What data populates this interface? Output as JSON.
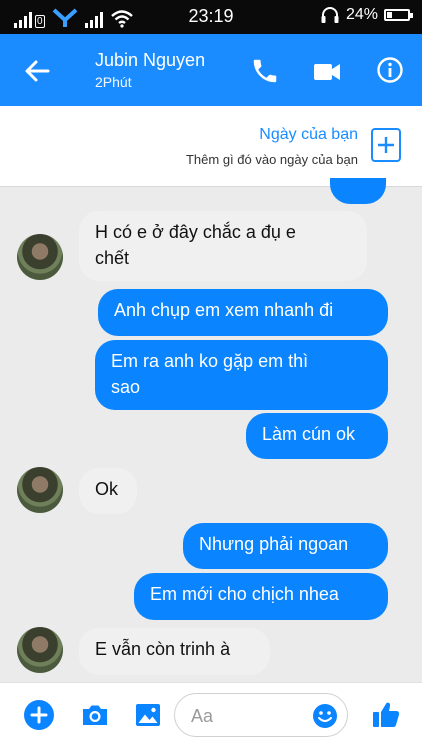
{
  "status_bar": {
    "sim_label": "0",
    "time": "23:19",
    "battery_percent": "24%",
    "battery_level": 0.24
  },
  "header": {
    "contact_name": "Jubin Nguyen",
    "contact_status": "2Phút",
    "icons": [
      "back-arrow-icon",
      "phone-icon",
      "video-camera-icon",
      "info-icon"
    ]
  },
  "day_banner": {
    "title": "Ngày của bạn",
    "subtitle": "Thêm gì đó vào ngày của bạn",
    "icon": "plus-icon"
  },
  "messages": [
    {
      "sender": "contact",
      "lines": [
        "H có e ở đây chắc a đụ e",
        "chết"
      ]
    },
    {
      "sender": "me",
      "lines": [
        "Anh chụp em xem nhanh đi"
      ]
    },
    {
      "sender": "me",
      "lines": [
        "Em ra anh ko gặp em thì",
        "sao"
      ]
    },
    {
      "sender": "me",
      "lines": [
        "Làm cún ok"
      ]
    },
    {
      "sender": "contact",
      "lines": [
        "Ok"
      ]
    },
    {
      "sender": "me",
      "lines": [
        "Nhưng phải ngoan"
      ]
    },
    {
      "sender": "me",
      "lines": [
        "Em mới cho chịch nhea"
      ]
    },
    {
      "sender": "contact",
      "lines": [
        "E vẫn còn trinh à"
      ]
    }
  ],
  "composer": {
    "placeholder": "Aa",
    "icons": [
      "plus-icon",
      "camera-icon",
      "image-icon",
      "emoji-icon",
      "thumbs-up-icon"
    ],
    "accent_color": "#0a84ff"
  },
  "colors": {
    "header_bg": "#1a8cff",
    "outgoing_bubble": "#0a84ff",
    "incoming_bubble": "#f1f0f0",
    "chat_bg": "#ebebeb"
  }
}
